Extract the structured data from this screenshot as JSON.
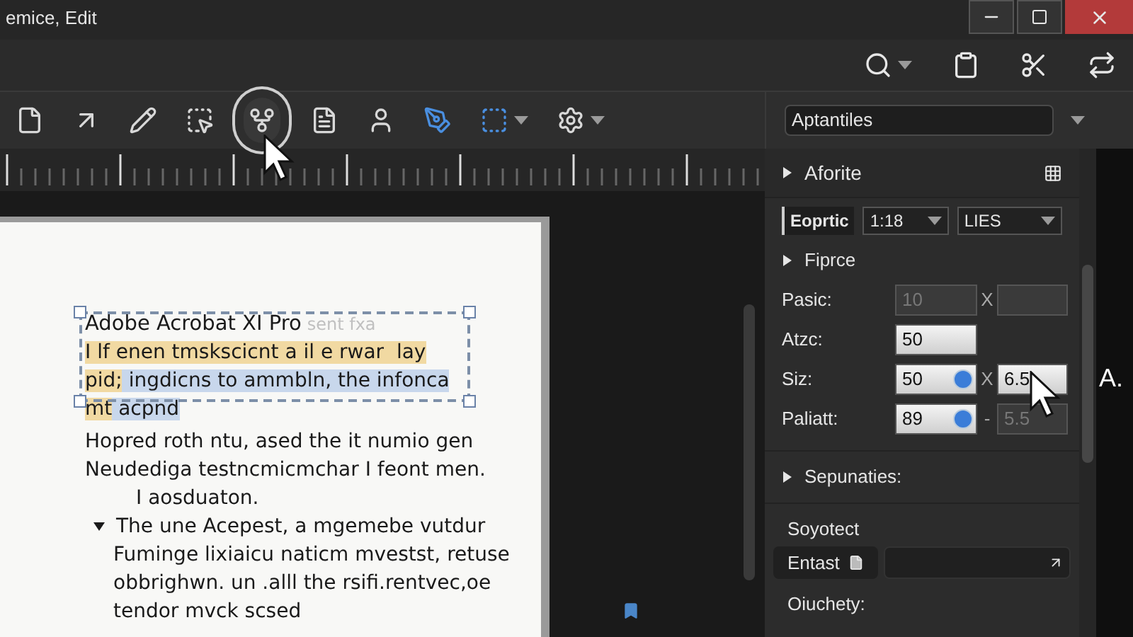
{
  "window": {
    "title": "emice, Edit"
  },
  "toolbar": {
    "tools": [
      {
        "kind": "page",
        "selected": false
      },
      {
        "kind": "arrow",
        "selected": false
      },
      {
        "kind": "pencil",
        "selected": false
      },
      {
        "kind": "crop",
        "selected": false
      },
      {
        "kind": "branch",
        "selected": true
      },
      {
        "kind": "note",
        "selected": false
      },
      {
        "kind": "person",
        "selected": false
      },
      {
        "kind": "pen",
        "selected": false
      },
      {
        "kind": "frame",
        "selected": false
      },
      {
        "kind": "settings",
        "selected": false
      }
    ]
  },
  "document": {
    "heading": "Adobe Acrobat XI Pro",
    "heading_ghost": "sent fxa",
    "selection": [
      [
        {
          "text": "I lf enen tmskscicnt a il e rwar  lay",
          "color": "#f1d9a2"
        }
      ],
      [
        {
          "text": "pid;",
          "color": "#f1d9a2"
        },
        {
          "text": " ingdicns to ammbln, the infonca",
          "color": "#c8d7ec"
        }
      ],
      [
        {
          "text": "mt",
          "color": "#f1d9a2"
        },
        {
          "text": " acpnd",
          "color": "#c8d7ec"
        }
      ]
    ],
    "lines": [
      {
        "text": "Hopred roth ntu, ased the it numio gen",
        "kind": "body"
      },
      {
        "text": "Neudediga testncmicmchar I feont men.",
        "kind": "body"
      },
      {
        "text": "I aosduaton.",
        "kind": "indent"
      },
      {
        "text": "The une Acepest,  a mgemebe vutdur",
        "kind": "bullet"
      },
      {
        "text": "Fuminge lixiaicu naticm mvestst, retuse",
        "kind": "continuation"
      },
      {
        "text": "obbrighwn. un .alll the rsifi.rentvec,oe",
        "kind": "continuation"
      },
      {
        "text": "tendor mvck scsed",
        "kind": "continuation"
      }
    ]
  },
  "panel": {
    "dropdown": "Aptantiles",
    "section_1": {
      "title": "Aforite"
    },
    "format_row": {
      "button": "Eoprtic",
      "scale": "1:18",
      "units": "LIES"
    },
    "section_2": {
      "title": "Fiprce"
    },
    "fields": [
      {
        "label": "Pasic:",
        "kind": "pair",
        "value": "10",
        "disabled": true,
        "knob": false,
        "separator": "X",
        "second": {
          "disabled": true
        }
      },
      {
        "label": "Atzc:",
        "kind": "single",
        "value": "50",
        "disabled": false,
        "knob": false
      },
      {
        "label": "Siz:",
        "kind": "pair",
        "value": "50",
        "disabled": false,
        "knob": true,
        "separator": "X",
        "second": {
          "value": "6.5",
          "disabled": false
        }
      },
      {
        "label": "Paliatt:",
        "kind": "pair",
        "value": "89",
        "disabled": false,
        "knob": true,
        "separator": "-",
        "second": {
          "value": "5.5",
          "disabled": true
        }
      }
    ],
    "section_3": {
      "title": "Sepunaties:"
    },
    "label_1": "Soyotect",
    "entry": {
      "label": "Entast"
    },
    "label_2": "Oiuchety:"
  },
  "side_letter": "A."
}
